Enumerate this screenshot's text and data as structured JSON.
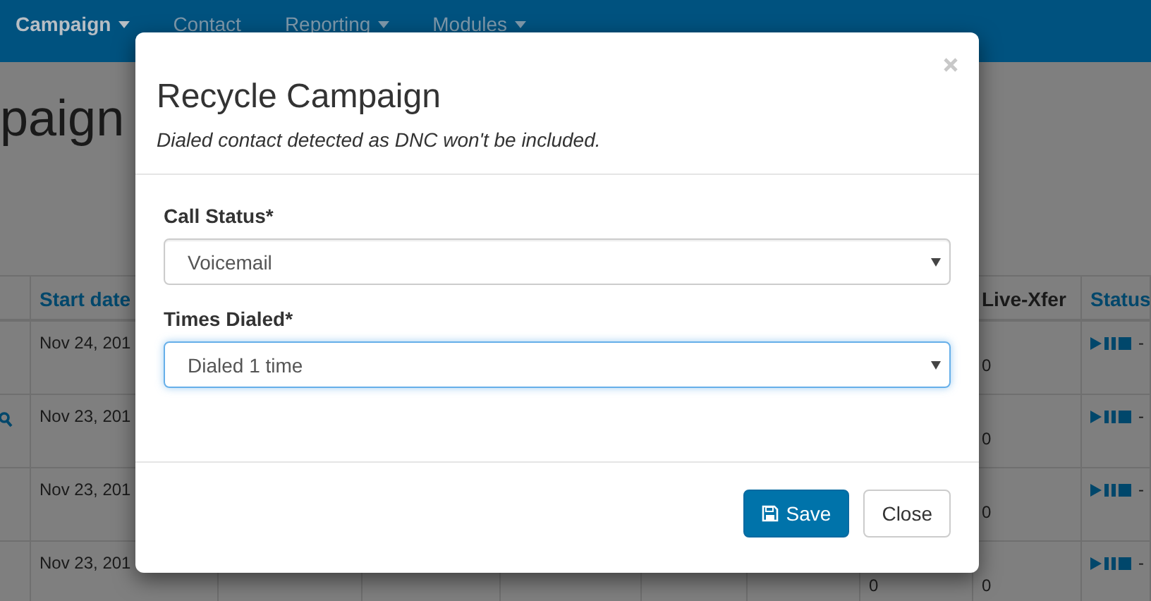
{
  "navbar": {
    "items": [
      {
        "label": "Campaign",
        "dropdown": true,
        "selected": true
      },
      {
        "label": "Contact",
        "dropdown": false,
        "selected": false
      },
      {
        "label": "Reporting",
        "dropdown": true,
        "selected": false
      },
      {
        "label": "Modules",
        "dropdown": true,
        "selected": false
      }
    ]
  },
  "page_title": "paign",
  "table": {
    "columns": [
      "Start date",
      "Live-Xfer",
      "Status"
    ],
    "rows": [
      {
        "search": false,
        "start_date": "Nov 24, 201",
        "live_xfer": "0",
        "status": "-"
      },
      {
        "search": true,
        "start_date": "Nov 23, 201",
        "live_xfer": "0",
        "status": "-"
      },
      {
        "search": false,
        "start_date": "Nov 23, 201",
        "live_xfer": "0",
        "status": "-"
      },
      {
        "search": false,
        "start_date": "Nov 23, 201",
        "column_hidden": "0",
        "live_xfer": "0",
        "status": "-"
      }
    ]
  },
  "modal": {
    "title": "Recycle Campaign",
    "subtitle": "Dialed contact detected as DNC won't be included.",
    "fields": [
      {
        "label": "Call Status*",
        "value": "Voicemail",
        "focused": false
      },
      {
        "label": "Times Dialed*",
        "value": "Dialed 1 time",
        "focused": true
      }
    ],
    "buttons": [
      {
        "label": "Save",
        "kind": "primary"
      },
      {
        "label": "Close",
        "kind": "default"
      }
    ]
  }
}
